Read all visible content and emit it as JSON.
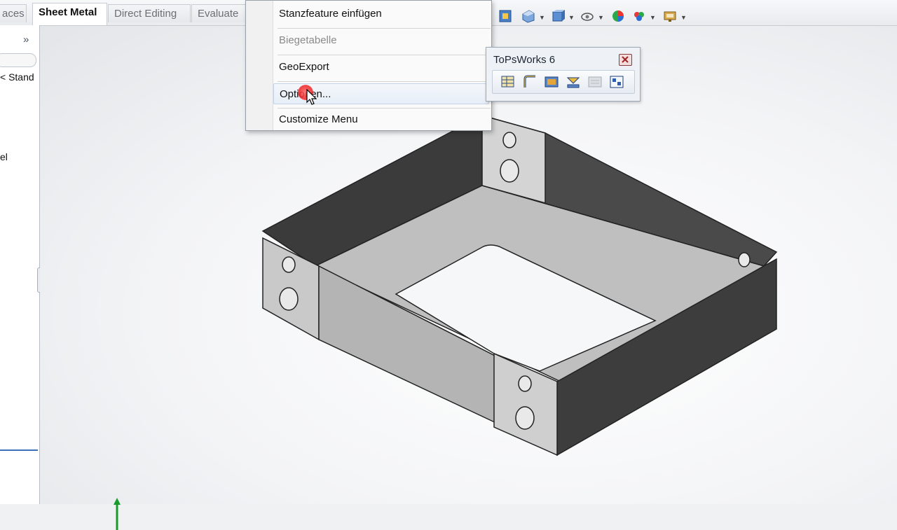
{
  "tabs": [
    {
      "label": "aces",
      "active": false
    },
    {
      "label": "Sheet Metal",
      "active": true
    },
    {
      "label": "Direct Editing",
      "active": false
    },
    {
      "label": "Evaluate",
      "active": false
    }
  ],
  "left_panel": {
    "expand_glyph": "»",
    "line1": "< Stand",
    "line2": "el"
  },
  "menu": {
    "items": [
      {
        "label": "Stanzfeature einfügen",
        "disabled": false
      },
      {
        "label": "Biegetabelle",
        "disabled": true
      },
      {
        "label": "GeoExport",
        "disabled": false
      },
      {
        "label": "Optionen...",
        "disabled": false,
        "hover": true
      },
      {
        "label": "Customize Menu",
        "disabled": false
      }
    ]
  },
  "topsworks": {
    "title": "ToPsWorks 6",
    "buttons": [
      "table-icon",
      "bend-icon",
      "export-icon",
      "flatten-icon",
      "disabled-icon",
      "options-icon"
    ]
  },
  "toolbar_icons": [
    "view-cube-icon",
    "section-icon",
    "display-style-icon",
    "hide-show-icon",
    "appearance-icon",
    "scene-icon",
    "monitor-icon"
  ],
  "colors": {
    "accent": "#3b6fb6",
    "close_red": "#c0392b"
  }
}
